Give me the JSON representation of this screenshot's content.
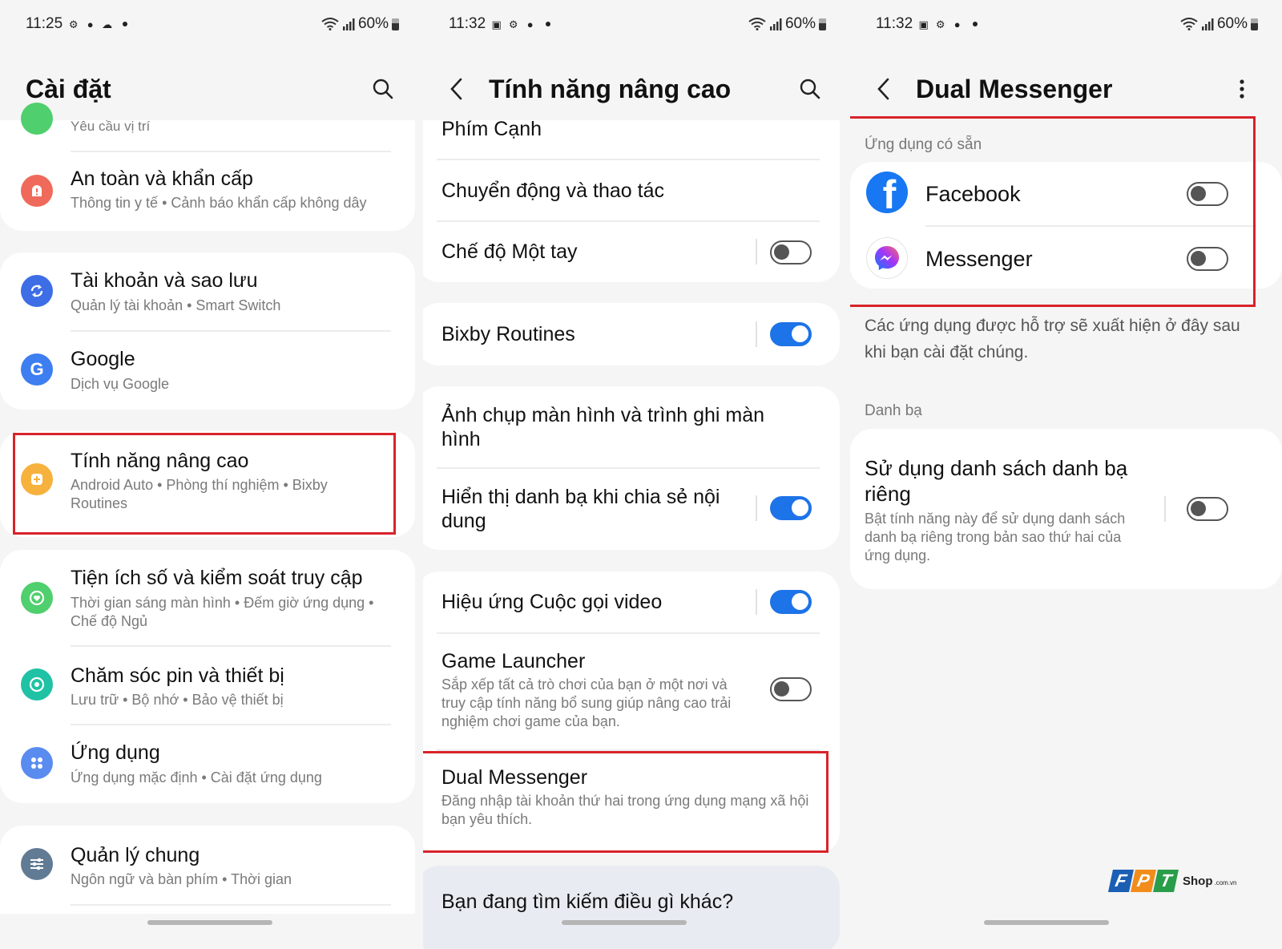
{
  "panel1": {
    "status": {
      "time": "11:25",
      "battery": "60%"
    },
    "title": "Cài đặt",
    "items": [
      {
        "subtitle": "Yêu cầu vị trí"
      },
      {
        "title": "An toàn và khẩn cấp",
        "subtitle": "Thông tin y tế  •  Cảnh báo khẩn cấp không dây",
        "color": "#ef6a5b"
      },
      {
        "title": "Tài khoản và sao lưu",
        "subtitle": "Quản lý tài khoản  •  Smart Switch",
        "color": "#3d6ee6"
      },
      {
        "title": "Google",
        "subtitle": "Dịch vụ Google",
        "color": "#3d7ef0"
      },
      {
        "title": "Tính năng nâng cao",
        "subtitle": "Android Auto  •  Phòng thí nghiệm  •  Bixby Routines",
        "color": "#f7b13d"
      },
      {
        "title": "Tiện ích số và kiểm soát truy cập",
        "subtitle": "Thời gian sáng màn hình  •  Đếm giờ ứng dụng  •  Chế độ Ngủ",
        "color": "#4fcf6d"
      },
      {
        "title": "Chăm sóc pin và thiết bị",
        "subtitle": "Lưu trữ  •  Bộ nhớ  •  Bảo vệ thiết bị",
        "color": "#1fc2a4"
      },
      {
        "title": "Ứng dụng",
        "subtitle": "Ứng dụng mặc định  •  Cài đặt ứng dụng",
        "color": "#5a8cf0"
      },
      {
        "title": "Quản lý chung",
        "subtitle": "Ngôn ngữ và bàn phím  •  Thời gian",
        "color": "#627b94"
      }
    ]
  },
  "panel2": {
    "status": {
      "time": "11:32",
      "battery": "60%"
    },
    "title": "Tính năng nâng cao",
    "items": [
      {
        "title": "Phím Cạnh"
      },
      {
        "title": "Chuyển động và thao tác"
      },
      {
        "title": "Chế độ Một tay",
        "toggle": false
      },
      {
        "title": "Bixby Routines",
        "toggle": true
      },
      {
        "title": "Ảnh chụp màn hình và trình ghi màn hình"
      },
      {
        "title": "Hiển thị danh bạ khi chia sẻ nội dung",
        "toggle": true
      },
      {
        "title": "Hiệu ứng Cuộc gọi video",
        "toggle": true
      },
      {
        "title": "Game Launcher",
        "subtitle": "Sắp xếp tất cả trò chơi của bạn ở một nơi và truy cập tính năng bổ sung giúp nâng cao trải nghiệm chơi game của bạn.",
        "toggle": false
      },
      {
        "title": "Dual Messenger",
        "subtitle": "Đăng nhập tài khoản thứ hai trong ứng dụng mạng xã hội bạn yêu thích."
      }
    ],
    "search_prompt": "Bạn đang tìm kiếm điều gì khác?"
  },
  "panel3": {
    "status": {
      "time": "11:32",
      "battery": "60%"
    },
    "title": "Dual Messenger",
    "section_available": "Ứng dụng có sẵn",
    "apps": [
      {
        "name": "Facebook",
        "toggle": false,
        "color": "#1877f2"
      },
      {
        "name": "Messenger",
        "toggle": false,
        "color": "#a334fa"
      }
    ],
    "note": "Các ứng dụng được hỗ trợ sẽ xuất hiện ở đây sau khi bạn cài đặt chúng.",
    "section_contacts": "Danh bạ",
    "contacts_item": {
      "title": "Sử dụng danh sách danh bạ riêng",
      "subtitle": "Bật tính năng này để sử dụng danh sách danh bạ riêng trong bản sao thứ hai của ứng dụng.",
      "toggle": false
    }
  },
  "watermark": {
    "letters": [
      "F",
      "P",
      "T"
    ],
    "suffix": "Shop",
    "domain": ".com.vn",
    "colors": [
      "#1a5fb4",
      "#f28c1b",
      "#2a9d4a"
    ]
  },
  "colors": {
    "highlight": "#d8232a",
    "toggle_on": "#1d73e8"
  }
}
